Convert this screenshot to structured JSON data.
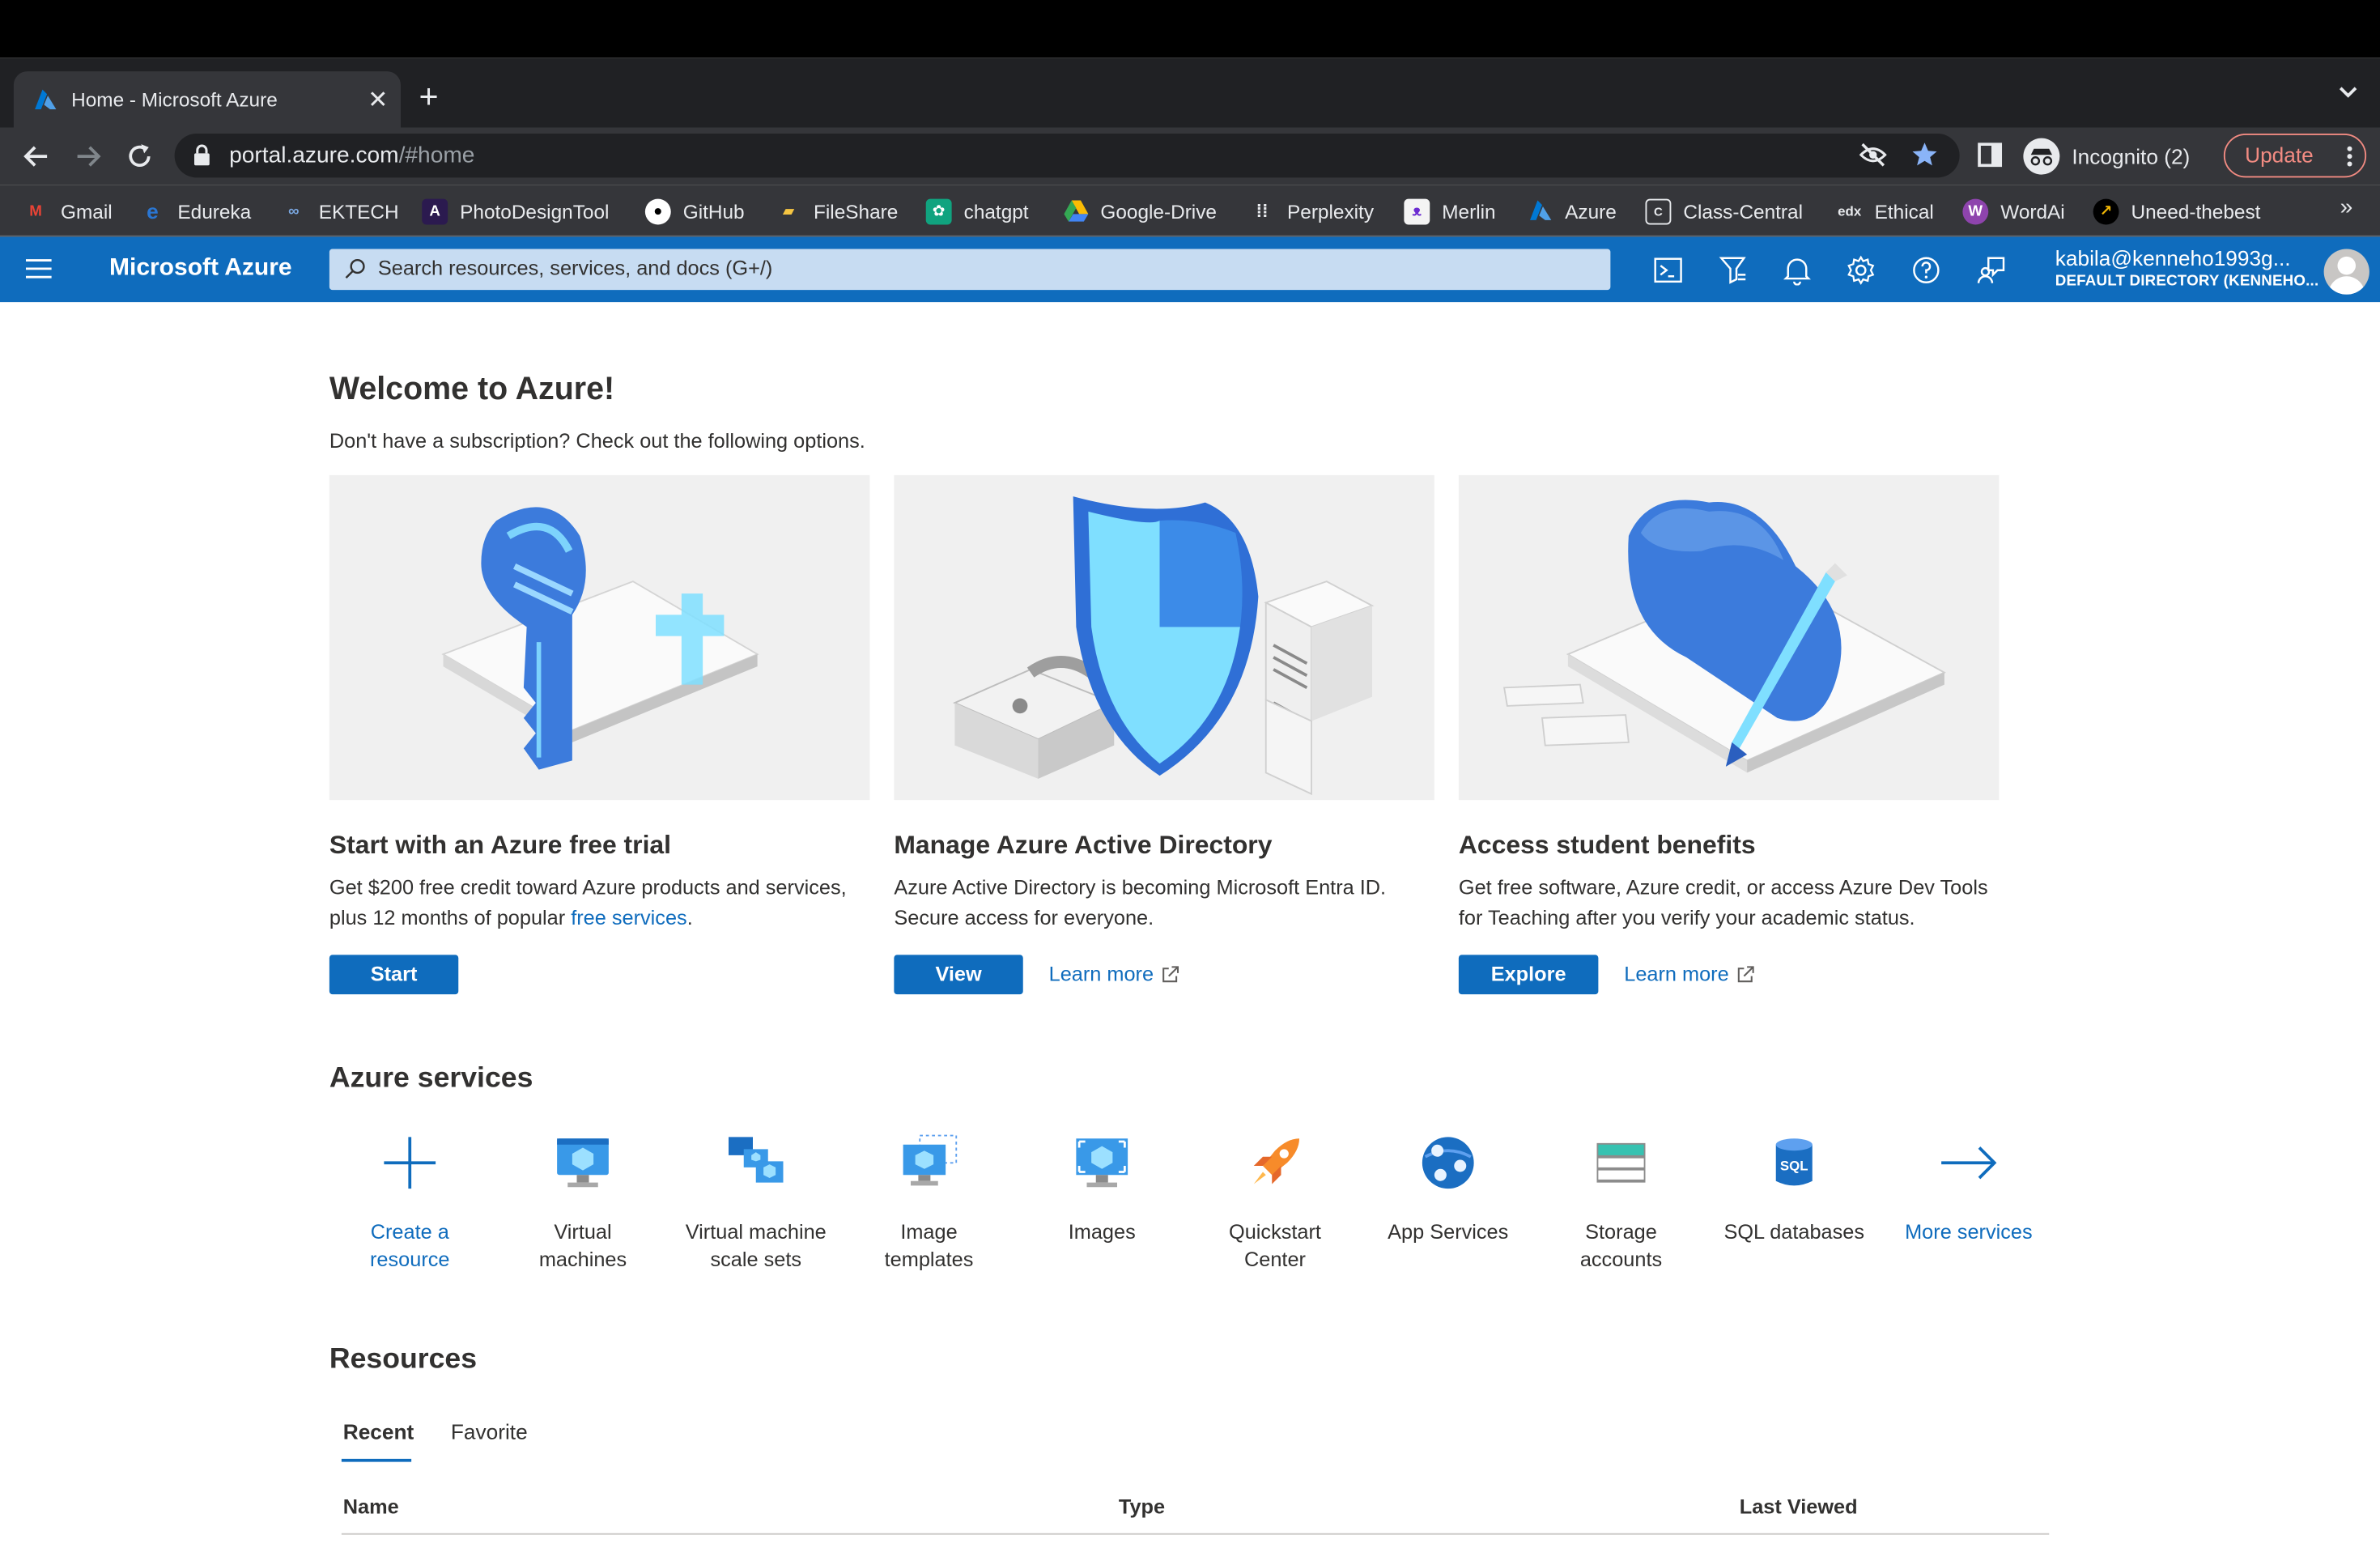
{
  "browser": {
    "tab_title": "Home - Microsoft Azure",
    "url_host": "portal.azure.com",
    "url_path": "/#home",
    "incognito_label": "Incognito (2)",
    "update_label": "Update"
  },
  "bookmarks": [
    {
      "label": "Gmail",
      "icon": "gmail-icon",
      "color": "#ea4335"
    },
    {
      "label": "Edureka",
      "icon": "edureka-icon",
      "color": "#2a76d2"
    },
    {
      "label": "EKTECH",
      "icon": "ektech-icon",
      "color": "#7aa7e0"
    },
    {
      "label": "PhotoDesignTool",
      "icon": "photodesign-icon",
      "color": "#6b2bd1"
    },
    {
      "label": "GitHub",
      "icon": "github-icon",
      "color": "#ffffff"
    },
    {
      "label": "FileShare",
      "icon": "fileshare-icon",
      "color": "#f5c542"
    },
    {
      "label": "chatgpt",
      "icon": "chatgpt-icon",
      "color": "#10a37f"
    },
    {
      "label": "Google-Drive",
      "icon": "google-drive-icon",
      "color": "#34a853"
    },
    {
      "label": "Perplexity",
      "icon": "perplexity-icon",
      "color": "#e8eaed"
    },
    {
      "label": "Merlin",
      "icon": "merlin-icon",
      "color": "#f4f4f4"
    },
    {
      "label": "Azure",
      "icon": "azure-icon",
      "color": "#0f6cbd"
    },
    {
      "label": "Class-Central",
      "icon": "class-central-icon",
      "color": "#e8eaed"
    },
    {
      "label": "Ethical",
      "icon": "edx-icon",
      "color": "#e8eaed"
    },
    {
      "label": "WordAi",
      "icon": "wordai-icon",
      "color": "#8e44ad"
    },
    {
      "label": "Uneed-thebest",
      "icon": "uneed-icon",
      "color": "#f2b705"
    }
  ],
  "azure_header": {
    "brand": "Microsoft Azure",
    "search_placeholder": "Search resources, services, and docs (G+/)",
    "account_email": "kabila@kenneho1993g...",
    "account_directory": "DEFAULT DIRECTORY (KENNEHO..."
  },
  "welcome": {
    "title": "Welcome to Azure!",
    "subtitle": "Don't have a subscription? Check out the following options."
  },
  "cards": [
    {
      "title": "Start with an Azure free trial",
      "desc_before": "Get $200 free credit toward Azure products and services, plus 12 months of popular ",
      "desc_link": "free services",
      "desc_after": ".",
      "button": "Start"
    },
    {
      "title": "Manage Azure Active Directory",
      "desc": "Azure Active Directory is becoming Microsoft Entra ID. Secure access for everyone.",
      "button": "View",
      "learn_more": "Learn more"
    },
    {
      "title": "Access student benefits",
      "desc": "Get free software, Azure credit, or access Azure Dev Tools for Teaching after you verify your academic status.",
      "button": "Explore",
      "learn_more": "Learn more"
    }
  ],
  "services": {
    "title": "Azure services",
    "items": [
      {
        "line1": "Create a",
        "line2": "resource",
        "icon": "plus-icon"
      },
      {
        "line1": "Virtual",
        "line2": "machines",
        "icon": "virtual-machine-icon"
      },
      {
        "line1": "Virtual machine",
        "line2": "scale sets",
        "icon": "vm-scale-sets-icon"
      },
      {
        "line1": "Image",
        "line2": "templates",
        "icon": "image-templates-icon"
      },
      {
        "line1": "Images",
        "line2": "",
        "icon": "images-icon"
      },
      {
        "line1": "Quickstart",
        "line2": "Center",
        "icon": "rocket-icon"
      },
      {
        "line1": "App Services",
        "line2": "",
        "icon": "app-services-icon"
      },
      {
        "line1": "Storage",
        "line2": "accounts",
        "icon": "storage-accounts-icon"
      },
      {
        "line1": "SQL databases",
        "line2": "",
        "icon": "sql-database-icon"
      },
      {
        "line1": "More services",
        "line2": "",
        "icon": "arrow-right-icon"
      }
    ]
  },
  "resources": {
    "title": "Resources",
    "tabs": [
      "Recent",
      "Favorite"
    ],
    "columns": [
      "Name",
      "Type",
      "Last Viewed"
    ]
  },
  "colors": {
    "azure_blue": "#0f6cbd",
    "chrome_dark": "#202124",
    "chrome_toolbar": "#35363a",
    "update_accent": "#f28b82"
  }
}
